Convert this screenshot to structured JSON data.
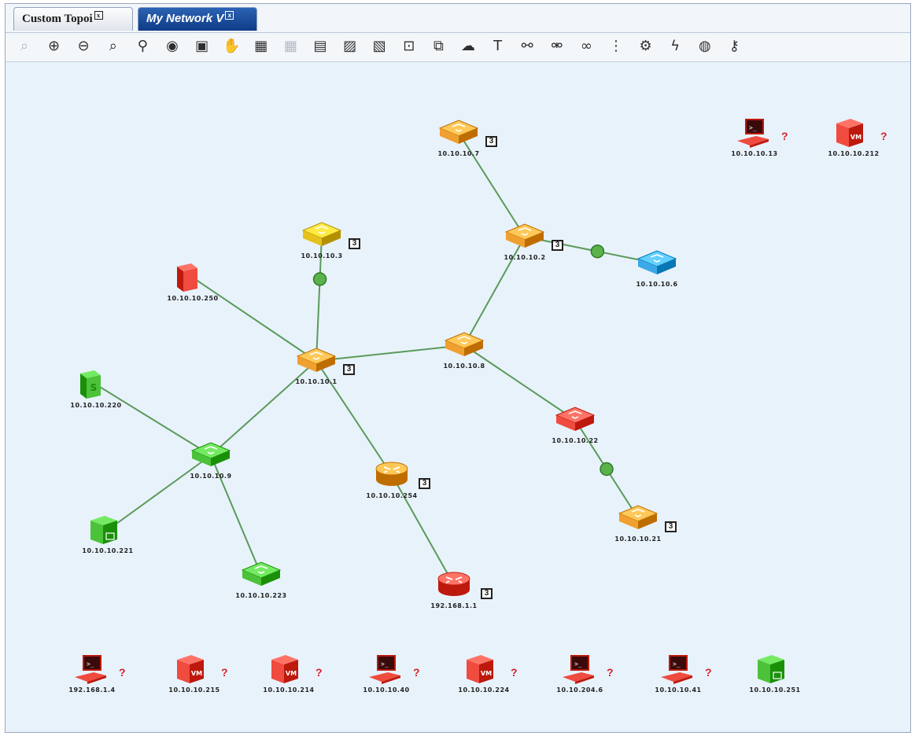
{
  "tabs": [
    {
      "label": "Custom Topoi",
      "active": false
    },
    {
      "label": "My Network V",
      "active": true
    }
  ],
  "toolbar": [
    "zoom-reset-icon",
    "zoom-in-icon",
    "zoom-out-icon",
    "zoom-fit-icon",
    "search-icon",
    "eye-icon",
    "fit-screen-icon",
    "hand-icon",
    "layout-icon",
    "layout-disabled-icon",
    "save-icon",
    "image-icon",
    "export-icon",
    "select-area-icon",
    "device-add-icon",
    "cloud-icon",
    "text-icon",
    "link-add-icon",
    "link-edit-icon",
    "binoculars-icon",
    "mib-icon",
    "mib-settings-icon",
    "lightning-icon",
    "globe-settings-icon",
    "key-icon"
  ],
  "colors": {
    "orange": "#f0a030",
    "yellow": "#e5c21c",
    "red": "#ef4b3f",
    "blue": "#3ba8e8",
    "green": "#4cc23a",
    "link": "#5a9a5a"
  },
  "nodes": [
    {
      "id": "n1",
      "label": "10.10.10.7",
      "type": "switch",
      "color": "orange",
      "badge": "3"
    },
    {
      "id": "n2",
      "label": "10.10.10.2",
      "type": "switch",
      "color": "orange",
      "badge": "3"
    },
    {
      "id": "n3",
      "label": "10.10.10.6",
      "type": "switch",
      "color": "blue"
    },
    {
      "id": "n4",
      "label": "10.10.10.3",
      "type": "switch",
      "color": "yellow",
      "badge": "3"
    },
    {
      "id": "n5",
      "label": "10.10.10.250",
      "type": "server",
      "color": "red"
    },
    {
      "id": "n6",
      "label": "10.10.10.1",
      "type": "switch",
      "color": "orange",
      "badge": "3"
    },
    {
      "id": "n7",
      "label": "10.10.10.8",
      "type": "switch",
      "color": "orange"
    },
    {
      "id": "n8",
      "label": "10.10.10.220",
      "type": "server",
      "color": "green",
      "icon_letter": "S"
    },
    {
      "id": "n9",
      "label": "10.10.10.9",
      "type": "switch",
      "color": "green"
    },
    {
      "id": "n10",
      "label": "10.10.10.254",
      "type": "router",
      "color": "orange",
      "badge": "3"
    },
    {
      "id": "n11",
      "label": "10.10.10.22",
      "type": "switch",
      "color": "red"
    },
    {
      "id": "n12",
      "label": "10.10.10.21",
      "type": "switch",
      "color": "orange",
      "badge": "3"
    },
    {
      "id": "n13",
      "label": "10.10.10.221",
      "type": "cube",
      "color": "green"
    },
    {
      "id": "n14",
      "label": "10.10.10.223",
      "type": "switch",
      "color": "green"
    },
    {
      "id": "n15",
      "label": "192.168.1.1",
      "type": "router",
      "color": "red",
      "badge": "3"
    },
    {
      "id": "n16",
      "label": "10.10.10.13",
      "type": "pc",
      "color": "red",
      "unknown": true
    },
    {
      "id": "n17",
      "label": "10.10.10.212",
      "type": "vm",
      "color": "red",
      "unknown": true
    },
    {
      "id": "n18",
      "label": "192.168.1.4",
      "type": "pc",
      "color": "red",
      "unknown": true
    },
    {
      "id": "n19",
      "label": "10.10.10.215",
      "type": "vm",
      "color": "red",
      "unknown": true
    },
    {
      "id": "n20",
      "label": "10.10.10.214",
      "type": "vm",
      "color": "red",
      "unknown": true
    },
    {
      "id": "n21",
      "label": "10.10.10.40",
      "type": "pc",
      "color": "red",
      "unknown": true
    },
    {
      "id": "n22",
      "label": "10.10.10.224",
      "type": "vm",
      "color": "red",
      "unknown": true
    },
    {
      "id": "n23",
      "label": "10.10.204.6",
      "type": "pc",
      "color": "red",
      "unknown": true
    },
    {
      "id": "n24",
      "label": "10.10.10.41",
      "type": "pc",
      "color": "red",
      "unknown": true
    },
    {
      "id": "n25",
      "label": "10.10.10.251",
      "type": "cube",
      "color": "green"
    }
  ],
  "links": [
    [
      "n1",
      "n2"
    ],
    [
      "n2",
      "n3"
    ],
    [
      "n2",
      "n7"
    ],
    [
      "n7",
      "n6"
    ],
    [
      "n4",
      "n6"
    ],
    [
      "n5",
      "n6"
    ],
    [
      "n6",
      "n9"
    ],
    [
      "n6",
      "n10"
    ],
    [
      "n10",
      "n15"
    ],
    [
      "n8",
      "n9"
    ],
    [
      "n9",
      "n13"
    ],
    [
      "n9",
      "n14"
    ],
    [
      "n7",
      "n11"
    ],
    [
      "n11",
      "n12"
    ]
  ]
}
